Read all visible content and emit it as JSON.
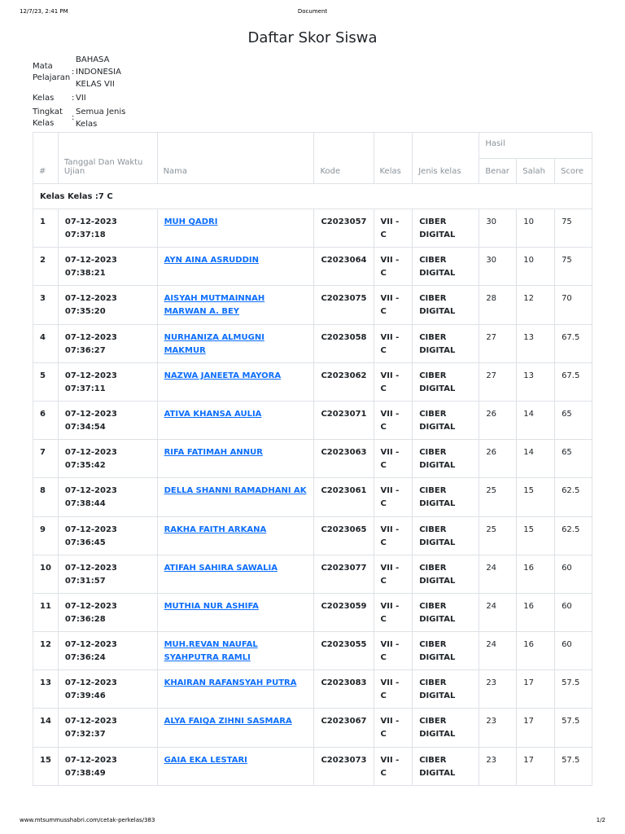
{
  "print": {
    "datetime": "12/7/23, 2:41 PM",
    "doc_title": "Document",
    "url": "www.mtsummusshabri.com/cetak-perkelas/383",
    "page": "1/2"
  },
  "title": "Daftar Skor Siswa",
  "meta": {
    "mapel_label_1": "Mata",
    "mapel_label_2": "Pelajaran",
    "mapel_value_1": "BAHASA",
    "mapel_value_2": "INDONESIA",
    "mapel_value_3": "KELAS VII",
    "kelas_label": "Kelas",
    "kelas_value": "VII",
    "tingkat_label_1": "Tingkat",
    "tingkat_label_2": "Kelas",
    "tingkat_value_1": "Semua Jenis",
    "tingkat_value_2": "Kelas",
    "colon": ":"
  },
  "table": {
    "headers": {
      "no": "#",
      "tanggal": "Tanggal Dan Waktu Ujian",
      "nama": "Nama",
      "kode": "Kode",
      "kelas": "Kelas",
      "jenis": "Jenis kelas",
      "hasil": "Hasil",
      "benar": "Benar",
      "salah": "Salah",
      "score": "Score"
    },
    "group_label": "Kelas Kelas :7 C",
    "rows": [
      {
        "no": "1",
        "tanggal": "07-12-2023 07:37:18",
        "nama": "MUH QADRI",
        "kode": "C2023057",
        "kelas": "VII - C",
        "jenis": "CIBER DIGITAL",
        "benar": "30",
        "salah": "10",
        "score": "75"
      },
      {
        "no": "2",
        "tanggal": "07-12-2023 07:38:21",
        "nama": "AYN AINA ASRUDDIN",
        "kode": "C2023064",
        "kelas": "VII - C",
        "jenis": "CIBER DIGITAL",
        "benar": "30",
        "salah": "10",
        "score": "75"
      },
      {
        "no": "3",
        "tanggal": "07-12-2023 07:35:20",
        "nama": "AISYAH MUTMAINNAH MARWAN A. BEY",
        "kode": "C2023075",
        "kelas": "VII - C",
        "jenis": "CIBER DIGITAL",
        "benar": "28",
        "salah": "12",
        "score": "70"
      },
      {
        "no": "4",
        "tanggal": "07-12-2023 07:36:27",
        "nama": "NURHANIZA ALMUGNI MAKMUR",
        "kode": "C2023058",
        "kelas": "VII - C",
        "jenis": "CIBER DIGITAL",
        "benar": "27",
        "salah": "13",
        "score": "67.5"
      },
      {
        "no": "5",
        "tanggal": "07-12-2023 07:37:11",
        "nama": "NAZWA JANEETA MAYORA",
        "kode": "C2023062",
        "kelas": "VII - C",
        "jenis": "CIBER DIGITAL",
        "benar": "27",
        "salah": "13",
        "score": "67.5"
      },
      {
        "no": "6",
        "tanggal": "07-12-2023 07:34:54",
        "nama": "ATIVA KHANSA AULIA",
        "kode": "C2023071",
        "kelas": "VII - C",
        "jenis": "CIBER DIGITAL",
        "benar": "26",
        "salah": "14",
        "score": "65"
      },
      {
        "no": "7",
        "tanggal": "07-12-2023 07:35:42",
        "nama": "RIFA FATIMAH ANNUR",
        "kode": "C2023063",
        "kelas": "VII - C",
        "jenis": "CIBER DIGITAL",
        "benar": "26",
        "salah": "14",
        "score": "65"
      },
      {
        "no": "8",
        "tanggal": "07-12-2023 07:38:44",
        "nama": "DELLA SHANNI RAMADHANI AK",
        "kode": "C2023061",
        "kelas": "VII - C",
        "jenis": "CIBER DIGITAL",
        "benar": "25",
        "salah": "15",
        "score": "62.5"
      },
      {
        "no": "9",
        "tanggal": "07-12-2023 07:36:45",
        "nama": "RAKHA FAITH ARKANA",
        "kode": "C2023065",
        "kelas": "VII - C",
        "jenis": "CIBER DIGITAL",
        "benar": "25",
        "salah": "15",
        "score": "62.5"
      },
      {
        "no": "10",
        "tanggal": "07-12-2023 07:31:57",
        "nama": "ATIFAH SAHIRA SAWALIA",
        "kode": "C2023077",
        "kelas": "VII - C",
        "jenis": "CIBER DIGITAL",
        "benar": "24",
        "salah": "16",
        "score": "60"
      },
      {
        "no": "11",
        "tanggal": "07-12-2023 07:36:28",
        "nama": "MUTHIA NUR ASHIFA",
        "kode": "C2023059",
        "kelas": "VII - C",
        "jenis": "CIBER DIGITAL",
        "benar": "24",
        "salah": "16",
        "score": "60"
      },
      {
        "no": "12",
        "tanggal": "07-12-2023 07:36:24",
        "nama": "MUH.REVAN NAUFAL SYAHPUTRA RAMLI",
        "kode": "C2023055",
        "kelas": "VII - C",
        "jenis": "CIBER DIGITAL",
        "benar": "24",
        "salah": "16",
        "score": "60"
      },
      {
        "no": "13",
        "tanggal": "07-12-2023 07:39:46",
        "nama": "KHAIRAN RAFANSYAH PUTRA",
        "kode": "C2023083",
        "kelas": "VII - C",
        "jenis": "CIBER DIGITAL",
        "benar": "23",
        "salah": "17",
        "score": "57.5"
      },
      {
        "no": "14",
        "tanggal": "07-12-2023 07:32:37",
        "nama": "ALYA FAIQA ZIHNI SASMARA",
        "kode": "C2023067",
        "kelas": "VII - C",
        "jenis": "CIBER DIGITAL",
        "benar": "23",
        "salah": "17",
        "score": "57.5"
      },
      {
        "no": "15",
        "tanggal": "07-12-2023 07:38:49",
        "nama": "GAIA EKA LESTARI",
        "kode": "C2023073",
        "kelas": "VII - C",
        "jenis": "CIBER DIGITAL",
        "benar": "23",
        "salah": "17",
        "score": "57.5"
      }
    ]
  }
}
